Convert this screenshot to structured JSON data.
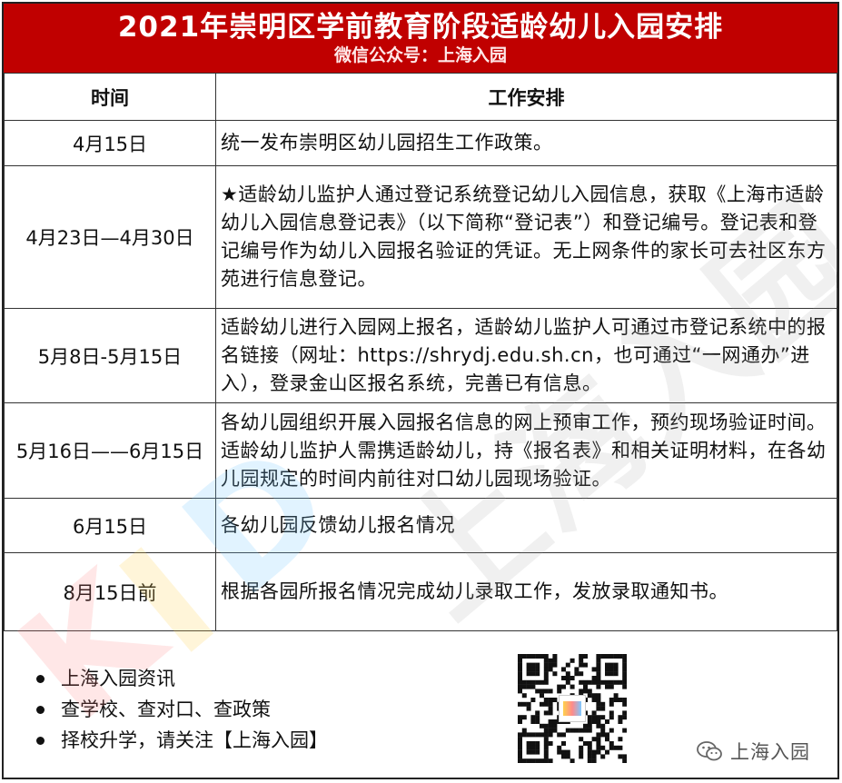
{
  "header": {
    "title": "2021年崇明区学前教育阶段适龄幼儿入园安排",
    "subtitle": "微信公众号：上海入园"
  },
  "table": {
    "columns": [
      "时间",
      "工作安排"
    ],
    "rows": [
      {
        "time": "4月15日",
        "desc": "统一发布崇明区幼儿园招生工作政策。"
      },
      {
        "time": "4月23日—4月30日",
        "desc": "★适龄幼儿监护人通过登记系统登记幼儿入园信息，获取《上海市适龄幼儿入园信息登记表》（以下简称“登记表”）和登记编号。登记表和登记编号作为幼儿入园报名验证的凭证。无上网条件的家长可去社区东方苑进行信息登记。"
      },
      {
        "time": "5月8日-5月15日",
        "desc": "适龄幼儿进行入园网上报名，适龄幼儿监护人可通过市登记系统中的报名链接（网址：https://shrydj.edu.sh.cn，也可通过“一网通办”进入），登录金山区报名系统，完善已有信息。"
      },
      {
        "time": "5月16日——6月15日",
        "desc": "各幼儿园组织开展入园报名信息的网上预审工作，预约现场验证时间。适龄幼儿监护人需携适龄幼儿，持《报名表》和相关证明材料，在各幼儿园规定的时间内前往对口幼儿园现场验证。"
      },
      {
        "time": "6月15日",
        "desc": "各幼儿园反馈幼儿报名情况"
      },
      {
        "time": "8月15日前",
        "desc": "根据各园所报名情况完成幼儿录取工作，发放录取通知书。"
      }
    ]
  },
  "footer": {
    "bullets": [
      "上海入园资讯",
      "查学校、查对口、查政策",
      "择校升学，请关注【上海入园】"
    ],
    "qr_logo_text": "上海入园",
    "wechat_label": "上海入园"
  },
  "watermark": {
    "letters": [
      "K",
      "I",
      "D"
    ],
    "text": "上海入园"
  },
  "colors": {
    "header_bg": "#c00000",
    "header_text": "#ffffff"
  }
}
